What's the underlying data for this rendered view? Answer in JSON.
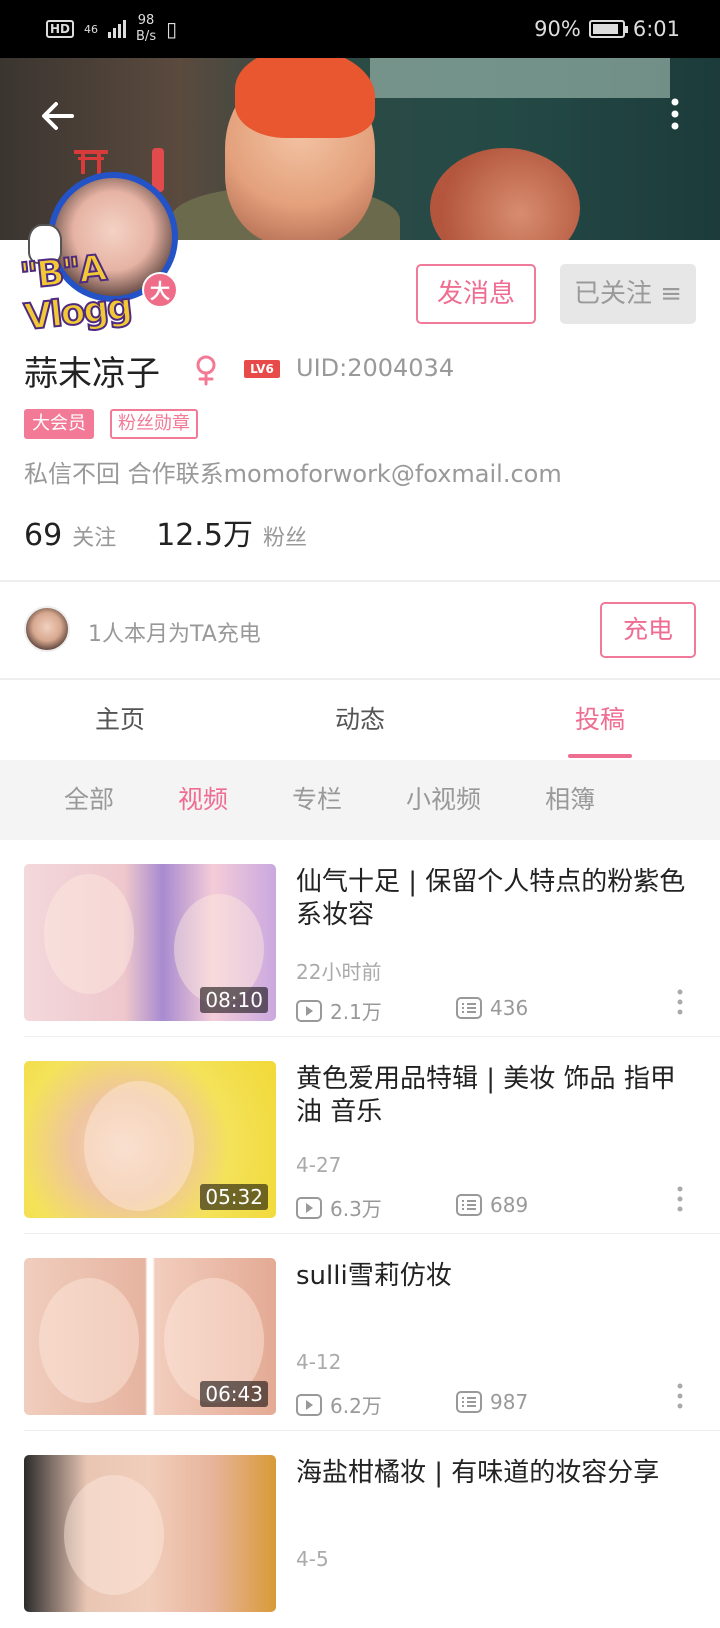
{
  "status_bar": {
    "hd": "HD",
    "network": "46",
    "speed_value": "98",
    "speed_unit": "B/s",
    "battery": "90%",
    "time": "6:01"
  },
  "header": {
    "back_icon": "arrow-left-icon",
    "more_icon": "more-vertical-icon"
  },
  "profile": {
    "avatar_text": "\"B\"A Vlogg",
    "avatar_badge": "大",
    "message_button": "发消息",
    "follow_button": "已关注 ≡",
    "name": "蒜末凉子",
    "level": "LV6",
    "uid": "UID:2004034",
    "tags": [
      "大会员",
      "粉丝勋章"
    ],
    "signature": "私信不回 合作联系momoforwork@foxmail.com",
    "following_count": "69",
    "following_label": "关注",
    "fans_count": "12.5万",
    "fans_label": "粉丝",
    "accent_color": "#ef6d91"
  },
  "charge": {
    "text": "1人本月为TA充电",
    "button": "充电"
  },
  "tabs": [
    {
      "label": "主页",
      "active": false
    },
    {
      "label": "动态",
      "active": false
    },
    {
      "label": "投稿",
      "active": true
    }
  ],
  "subtabs": [
    {
      "label": "全部",
      "active": false
    },
    {
      "label": "视频",
      "active": true
    },
    {
      "label": "专栏",
      "active": false
    },
    {
      "label": "小视频",
      "active": false
    },
    {
      "label": "相簿",
      "active": false
    }
  ],
  "videos": [
    {
      "title": "仙气十足 | 保留个人特点的粉紫色系妆容",
      "date": "22小时前",
      "duration": "08:10",
      "plays": "2.1万",
      "danmaku": "436"
    },
    {
      "title": "黄色爱用品特辑 | 美妆 饰品 指甲油 音乐",
      "date": "4-27",
      "duration": "05:32",
      "plays": "6.3万",
      "danmaku": "689"
    },
    {
      "title": "sulli雪莉仿妆",
      "date": "4-12",
      "duration": "06:43",
      "plays": "6.2万",
      "danmaku": "987"
    },
    {
      "title": "海盐柑橘妆 | 有味道的妆容分享",
      "date": "4-5",
      "duration": "",
      "plays": "",
      "danmaku": ""
    }
  ]
}
